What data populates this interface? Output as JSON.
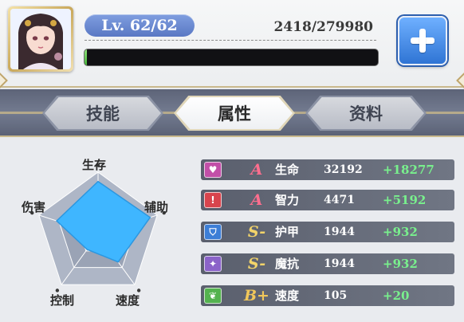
{
  "hero": {
    "level": "Lv. 62/62",
    "exp": "2418/279980",
    "exp_progress": 0.0086
  },
  "tabs": [
    {
      "label": "技能",
      "active": false
    },
    {
      "label": "属性",
      "active": true
    },
    {
      "label": "资料",
      "active": false
    }
  ],
  "radar": {
    "axes": [
      "生存",
      "辅助",
      "速度",
      "控制",
      "伤害"
    ],
    "values": [
      0.85,
      0.88,
      0.55,
      0.3,
      0.7
    ],
    "fill_color": "#3fb6ff"
  },
  "stats": [
    {
      "icon": "heart-icon",
      "icon_color": "#c24fa8",
      "grade": "A",
      "grade_color": "#ff6e8e",
      "name": "生命",
      "base": "32192",
      "bonus": "+18277"
    },
    {
      "icon": "brain-icon",
      "icon_color": "#d8444d",
      "grade": "A",
      "grade_color": "#ff6e8e",
      "name": "智力",
      "base": "4471",
      "bonus": "+5192"
    },
    {
      "icon": "shield-icon",
      "icon_color": "#3d7ed6",
      "grade": "S-",
      "grade_color": "#f3d46a",
      "name": "护甲",
      "base": "1944",
      "bonus": "+932"
    },
    {
      "icon": "magic-shield-icon",
      "icon_color": "#8b63c9",
      "grade": "S-",
      "grade_color": "#f3d46a",
      "name": "魔抗",
      "base": "1944",
      "bonus": "+932"
    },
    {
      "icon": "feather-icon",
      "icon_color": "#54b24f",
      "grade": "B+",
      "grade_color": "#f1c75a",
      "name": "速度",
      "base": "105",
      "bonus": "+20"
    }
  ]
}
